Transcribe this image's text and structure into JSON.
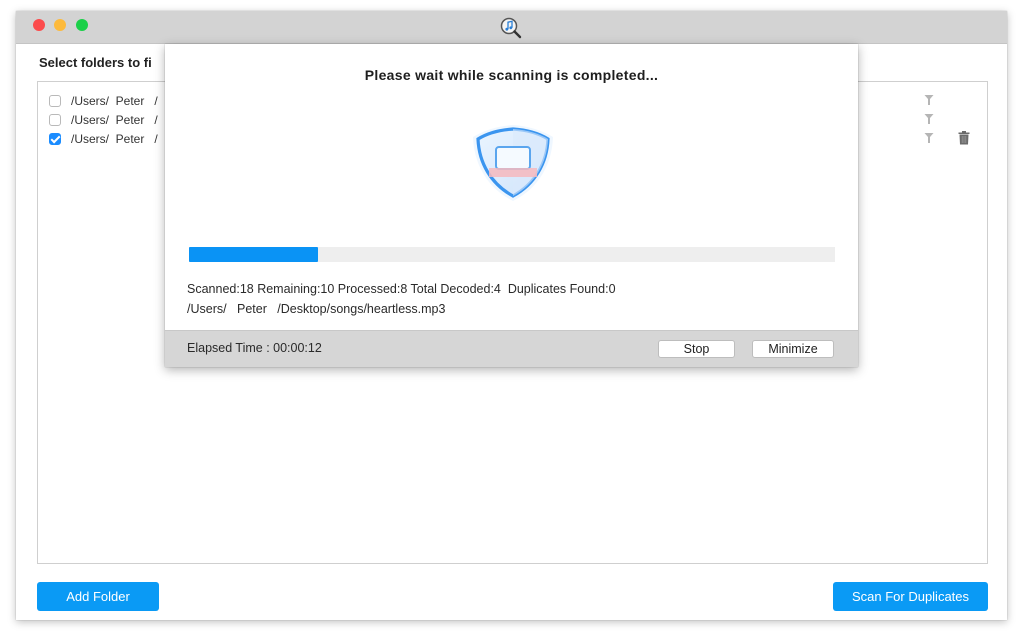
{
  "window": {
    "traffic_lights": [
      "close",
      "minimize",
      "maximize"
    ],
    "app_icon": "music-search-icon"
  },
  "main": {
    "section_title": "Select folders to fi",
    "folders": [
      {
        "path": "/Users/  Peter   /",
        "checked": false,
        "has_trash": false
      },
      {
        "path": "/Users/  Peter   /",
        "checked": false,
        "has_trash": false
      },
      {
        "path": "/Users/  Peter   /",
        "checked": true,
        "has_trash": true
      }
    ],
    "add_folder_label": "Add Folder",
    "scan_label": "Scan For Duplicates"
  },
  "modal": {
    "title": "Please wait while scanning is completed...",
    "icon": "shield-scan-icon",
    "progress_percent": 20,
    "stats": "Scanned:18 Remaining:10 Processed:8 Total Decoded:4  Duplicates Found:0",
    "current_file": "/Users/   Peter   /Desktop/songs/heartless.mp3",
    "elapsed": "Elapsed Time : 00:00:12",
    "stop_label": "Stop",
    "minimize_label": "Minimize"
  },
  "colors": {
    "accent": "#0a9af5",
    "titlebar": "#d3d3d3",
    "close": "#fc4b4c",
    "minimize": "#fdba3c",
    "maximize": "#1bd049"
  }
}
